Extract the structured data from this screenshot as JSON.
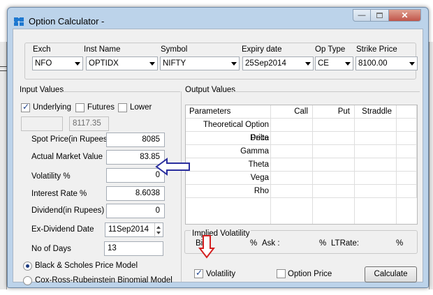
{
  "window": {
    "title": "Option Calculator -"
  },
  "header": {
    "fields": [
      {
        "label": "Exch",
        "value": "NFO"
      },
      {
        "label": "Inst Name",
        "value": "OPTIDX"
      },
      {
        "label": "Symbol",
        "value": "NIFTY"
      },
      {
        "label": "Expiry date",
        "value": "25Sep2014"
      },
      {
        "label": "Op Type",
        "value": "CE"
      },
      {
        "label": "Strike Price",
        "value": "8100.00"
      }
    ]
  },
  "input": {
    "title": "Input Values",
    "underlying_label": "Underlying",
    "futures_label": "Futures",
    "lower_label": "Lower",
    "underlying_value": "8117.35",
    "rows": [
      {
        "label": "Spot Price(in Rupees)",
        "value": "8085"
      },
      {
        "label": "Actual Market Value",
        "value": "83.85"
      },
      {
        "label": "Volatility %",
        "value": "0"
      },
      {
        "label": "Interest Rate %",
        "value": "8.6038"
      },
      {
        "label": "Dividend(in Rupees)",
        "value": "0"
      },
      {
        "label": "Ex-Dividend Date",
        "value": "11Sep2014"
      },
      {
        "label": "No of Days",
        "value": "13"
      }
    ],
    "model_bs": "Black & Scholes Price Model",
    "model_crr": "Cox-Ross-Rubeinstein Binomial Model"
  },
  "output": {
    "title": "Output Values",
    "columns": [
      "Parameters",
      "Call",
      "Put",
      "Straddle"
    ],
    "params": [
      "Theoretical Option Price",
      "Delta",
      "Gamma",
      "Theta",
      "Vega",
      "Rho"
    ]
  },
  "implied": {
    "title": "Implied Volatility",
    "bid_label": "Bid",
    "bid_pct": "%",
    "ask_label": "Ask :",
    "ask_pct": "%",
    "ltrate_label": "LTRate:",
    "lt_pct": "%"
  },
  "footer": {
    "volatility_label": "Volatility",
    "option_price_label": "Option Price",
    "calculate_label": "Calculate"
  },
  "annotations": {
    "blue_arrow_color": "#2a2e9e",
    "red_arrow_color": "#d42020"
  }
}
